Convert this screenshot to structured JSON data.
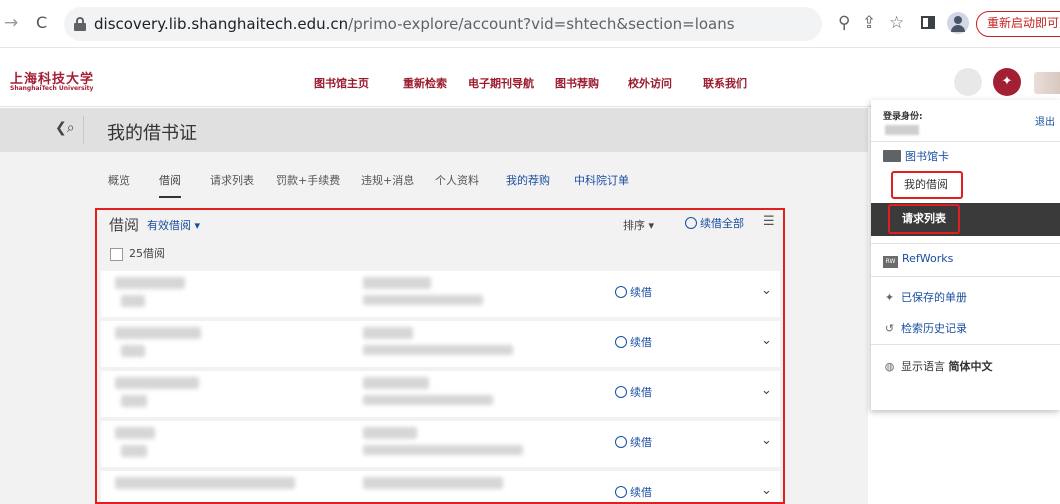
{
  "browser": {
    "url_host": "discovery.lib.shanghaitech.edu.cn",
    "url_path": "/primo-explore/account?vid=shtech&section=loans",
    "restart_label": "重新启动即可更"
  },
  "site": {
    "logo_cn": "上海科技大学",
    "logo_en": "ShanghaiTech University",
    "nav": [
      "图书馆主页",
      "重新检索",
      "电子期刊导航",
      "图书荐购",
      "校外访问",
      "联系我们"
    ]
  },
  "page": {
    "title": "我的借书证",
    "tabs": [
      "概览",
      "借阅",
      "请求列表",
      "罚款+手续费",
      "违规+消息",
      "个人资料",
      "我的荐购",
      "中科院订单"
    ],
    "active_tab": "借阅"
  },
  "loans": {
    "title": "借阅",
    "filter_label": "有效借阅",
    "sort_label": "排序",
    "renew_all_label": "续借全部",
    "count_label": "25借阅",
    "renew_label": "续借",
    "rows": 5
  },
  "user_menu": {
    "login_label": "登录身份:",
    "logout": "退出",
    "library_card": "图书馆卡",
    "my_loans": "我的借阅",
    "requests": "请求列表",
    "refworks": "RefWorks",
    "saved_items": "已保存的单册",
    "search_history": "检索历史记录",
    "language_label": "显示语言",
    "language_value": "简体中文"
  },
  "colors": {
    "brand": "#a31f34",
    "link": "#1a4fa0",
    "highlight": "#e0201e"
  }
}
